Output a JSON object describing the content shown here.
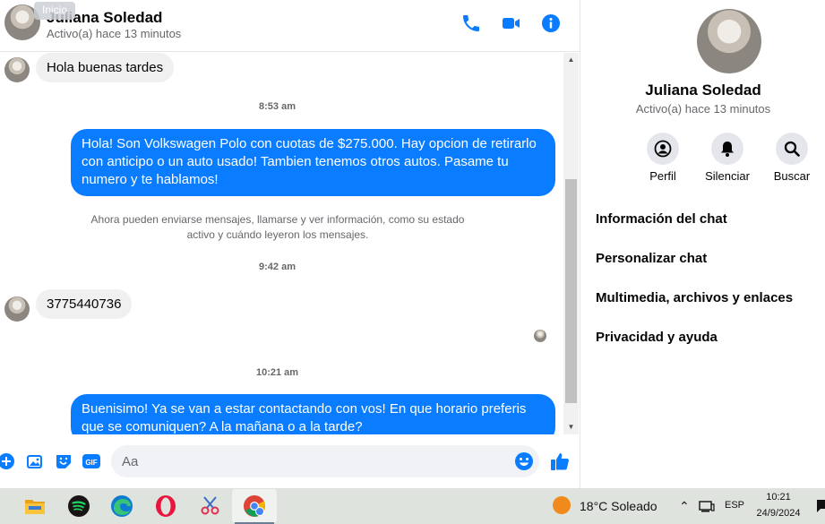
{
  "header": {
    "tooltip": "Inicio",
    "name": "Juliana Soledad",
    "status": "Activo(a) hace 13 minutos",
    "icons": [
      "phone-icon",
      "video-icon",
      "info-icon"
    ],
    "accent_color": "#0a7cff"
  },
  "messages": {
    "msg1": "Hola buenas tardes",
    "ts1": "8:53 am",
    "msg2": "Hola! Son Volkswagen Polo con cuotas de $275.000. Hay opcion de retirarlo con anticipo o un auto usado! Tambien tenemos otros autos. Pasame tu numero y te hablamos!",
    "notice": "Ahora pueden enviarse mensajes, llamarse y ver información, como su estado activo y cuándo leyeron los mensajes.",
    "ts2": "9:42 am",
    "msg3": "3775440736",
    "ts3": "10:21 am",
    "msg4": "Buenisimo! Ya se van a estar contactando con vos! En que horario preferis que se comuniquen? A la mañana o a la tarde?"
  },
  "composer": {
    "placeholder": "Aa",
    "icons": [
      "plus-icon",
      "image-icon",
      "sticker-icon",
      "gif-icon",
      "emoji-icon",
      "like-icon"
    ]
  },
  "panel": {
    "name": "Juliana Soledad",
    "status": "Activo(a) hace 13 minutos",
    "actions": [
      {
        "label": "Perfil",
        "icon": "profile-icon"
      },
      {
        "label": "Silenciar",
        "icon": "bell-icon"
      },
      {
        "label": "Buscar",
        "icon": "search-icon"
      }
    ],
    "menu": [
      "Información del chat",
      "Personalizar chat",
      "Multimedia, archivos y enlaces",
      "Privacidad y ayuda"
    ]
  },
  "taskbar": {
    "apps": [
      "file-explorer",
      "spotify",
      "edge",
      "opera",
      "snipping-tool",
      "chrome"
    ],
    "weather": "18°C  Soleado",
    "lang": "ESP",
    "time": "10:21",
    "date": "24/9/2024"
  }
}
